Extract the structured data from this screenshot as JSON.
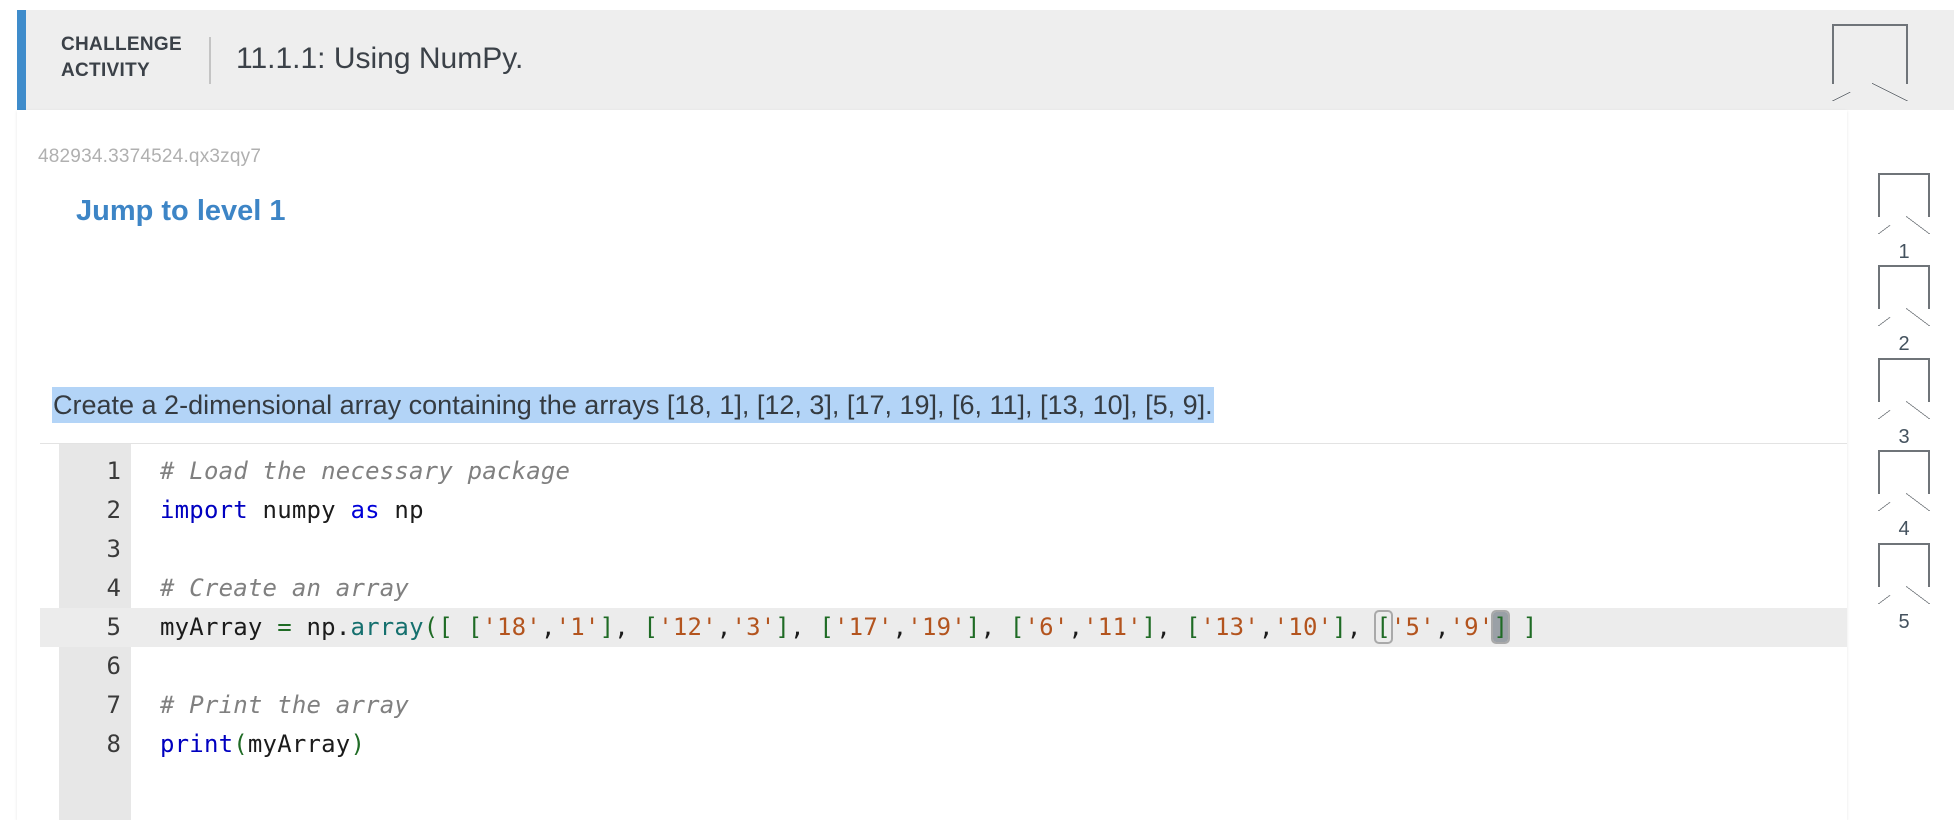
{
  "header": {
    "kicker": "CHALLENGE ACTIVITY",
    "title": "11.1.1: Using NumPy.",
    "accent_color": "#3f8ccb",
    "background_color": "#eeeeee",
    "badge_icon": "pentagon-badge-icon"
  },
  "body": {
    "activity_id": "482934.3374524.qx3zqy7",
    "jump_link": "Jump to level 1",
    "jump_link_color": "#3d85c6",
    "instruction": "Create a 2-dimensional array containing the arrays [18, 1], [12, 3], [17, 19], [6, 11], [13, 10], [5, 9].",
    "instruction_highlight_color": "#b3d4f7"
  },
  "editor": {
    "active_line": 5,
    "gutter_color": "#e7e7e7",
    "active_line_color": "#ececec",
    "lines": [
      {
        "number": "1",
        "segments": [
          {
            "t": "# Load the necessary package",
            "c": "tok-comment"
          }
        ]
      },
      {
        "number": "2",
        "segments": [
          {
            "t": "import",
            "c": "tok-keyword"
          },
          {
            "t": " numpy ",
            "c": "tok-plain"
          },
          {
            "t": "as",
            "c": "tok-kw2"
          },
          {
            "t": " np",
            "c": "tok-plain"
          }
        ]
      },
      {
        "number": "3",
        "segments": []
      },
      {
        "number": "4",
        "segments": [
          {
            "t": "# Create an array",
            "c": "tok-comment"
          }
        ]
      },
      {
        "number": "5",
        "segments": [
          {
            "t": "myArray ",
            "c": "tok-plain"
          },
          {
            "t": "=",
            "c": "tok-op"
          },
          {
            "t": " np",
            "c": "tok-plain"
          },
          {
            "t": ".",
            "c": "tok-plain"
          },
          {
            "t": "array",
            "c": "tok-func"
          },
          {
            "t": "(",
            "c": "tok-paren"
          },
          {
            "t": "[",
            "c": "tok-bracket"
          },
          {
            "t": " ",
            "c": "tok-plain"
          },
          {
            "t": "[",
            "c": "tok-bracket"
          },
          {
            "t": "'18'",
            "c": "tok-str"
          },
          {
            "t": ",",
            "c": "tok-plain"
          },
          {
            "t": "'1'",
            "c": "tok-str"
          },
          {
            "t": "]",
            "c": "tok-bracket"
          },
          {
            "t": ", ",
            "c": "tok-plain"
          },
          {
            "t": "[",
            "c": "tok-bracket"
          },
          {
            "t": "'12'",
            "c": "tok-str"
          },
          {
            "t": ",",
            "c": "tok-plain"
          },
          {
            "t": "'3'",
            "c": "tok-str"
          },
          {
            "t": "]",
            "c": "tok-bracket"
          },
          {
            "t": ", ",
            "c": "tok-plain"
          },
          {
            "t": "[",
            "c": "tok-bracket"
          },
          {
            "t": "'17'",
            "c": "tok-str"
          },
          {
            "t": ",",
            "c": "tok-plain"
          },
          {
            "t": "'19'",
            "c": "tok-str"
          },
          {
            "t": "]",
            "c": "tok-bracket"
          },
          {
            "t": ", ",
            "c": "tok-plain"
          },
          {
            "t": "[",
            "c": "tok-bracket"
          },
          {
            "t": "'6'",
            "c": "tok-str"
          },
          {
            "t": ",",
            "c": "tok-plain"
          },
          {
            "t": "'11'",
            "c": "tok-str"
          },
          {
            "t": "]",
            "c": "tok-bracket"
          },
          {
            "t": ", ",
            "c": "tok-plain"
          },
          {
            "t": "[",
            "c": "tok-bracket"
          },
          {
            "t": "'13'",
            "c": "tok-str"
          },
          {
            "t": ",",
            "c": "tok-plain"
          },
          {
            "t": "'10'",
            "c": "tok-str"
          },
          {
            "t": "]",
            "c": "tok-bracket"
          },
          {
            "t": ", ",
            "c": "tok-plain"
          },
          {
            "t": "[",
            "c": "tok-bracket bracket-match"
          },
          {
            "t": "'5'",
            "c": "tok-str"
          },
          {
            "t": ",",
            "c": "tok-plain"
          },
          {
            "t": "'9'",
            "c": "tok-str"
          },
          {
            "t": "]",
            "c": "tok-bracket bracket-match caret-on-char"
          },
          {
            "t": " ",
            "c": "tok-plain"
          },
          {
            "t": "]",
            "c": "tok-bracket"
          }
        ]
      },
      {
        "number": "6",
        "segments": []
      },
      {
        "number": "7",
        "segments": [
          {
            "t": "# Print the array",
            "c": "tok-comment"
          }
        ]
      },
      {
        "number": "8",
        "segments": [
          {
            "t": "print",
            "c": "tok-builtin"
          },
          {
            "t": "(",
            "c": "tok-paren"
          },
          {
            "t": "myArray",
            "c": "tok-plain"
          },
          {
            "t": ")",
            "c": "tok-paren"
          }
        ]
      }
    ]
  },
  "right_rail": {
    "items": [
      {
        "label": "1",
        "icon": "pentagon-badge-icon"
      },
      {
        "label": "2",
        "icon": "pentagon-badge-icon"
      },
      {
        "label": "3",
        "icon": "pentagon-badge-icon"
      },
      {
        "label": "4",
        "icon": "pentagon-badge-icon"
      },
      {
        "label": "5",
        "icon": "pentagon-badge-icon"
      }
    ]
  }
}
